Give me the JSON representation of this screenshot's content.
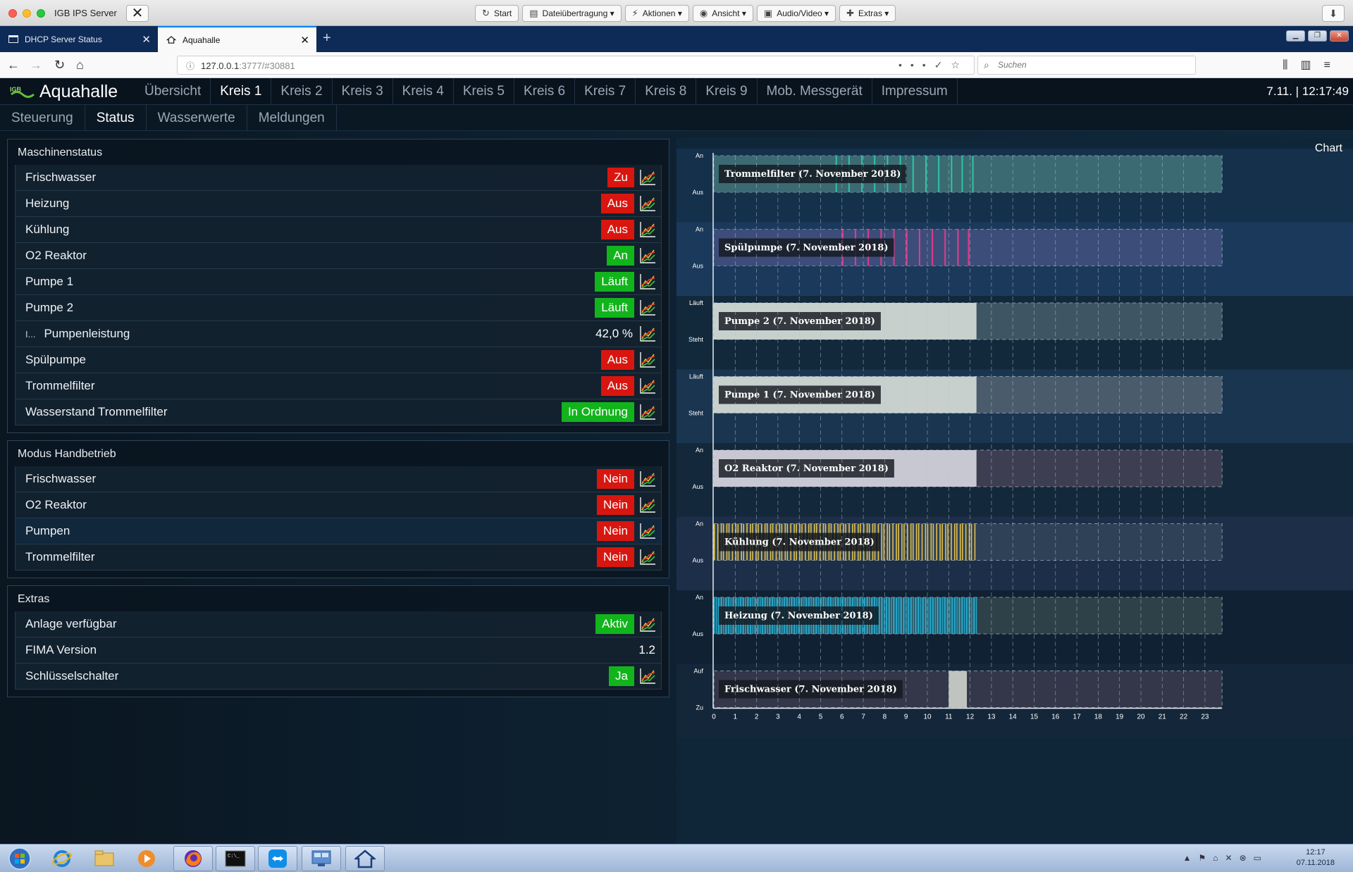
{
  "window": {
    "title": "IGB IPS Server"
  },
  "remote_toolbar": {
    "buttons": [
      {
        "label": "Start",
        "icon": "refresh-icon"
      },
      {
        "label": "Dateiübertragung ▾",
        "icon": "file-icon"
      },
      {
        "label": "Aktionen ▾",
        "icon": "lightning-icon"
      },
      {
        "label": "Ansicht ▾",
        "icon": "eye-icon"
      },
      {
        "label": "Audio/Video ▾",
        "icon": "chat-icon"
      },
      {
        "label": "Extras ▾",
        "icon": "puzzle-icon"
      }
    ]
  },
  "browser": {
    "tabs": [
      {
        "label": "DHCP Server Status"
      },
      {
        "label": "Aquahalle"
      }
    ],
    "url_host": "127.0.0.1",
    "url_rest": ":3777/#30881",
    "search_placeholder": "Suchen"
  },
  "app": {
    "name": "Aquahalle",
    "clock": "7.11. | 12:17:49",
    "main_tabs": [
      {
        "label": "Übersicht",
        "active": false
      },
      {
        "label": "Kreis 1",
        "active": true
      },
      {
        "label": "Kreis 2",
        "active": false
      },
      {
        "label": "Kreis 3",
        "active": false
      },
      {
        "label": "Kreis 4",
        "active": false
      },
      {
        "label": "Kreis 5",
        "active": false
      },
      {
        "label": "Kreis 6",
        "active": false
      },
      {
        "label": "Kreis 7",
        "active": false
      },
      {
        "label": "Kreis 8",
        "active": false
      },
      {
        "label": "Kreis 9",
        "active": false
      },
      {
        "label": "Mob. Messgerät",
        "active": false
      },
      {
        "label": "Impressum",
        "active": false
      }
    ],
    "sub_tabs": [
      {
        "label": "Steuerung",
        "active": false
      },
      {
        "label": "Status",
        "active": true
      },
      {
        "label": "Wasserwerte",
        "active": false
      },
      {
        "label": "Meldungen",
        "active": false
      }
    ]
  },
  "panels": [
    {
      "title": "Maschinenstatus",
      "rows": [
        {
          "label": "Frischwasser",
          "value": "Zu",
          "color": "red",
          "chart": true
        },
        {
          "label": "Heizung",
          "value": "Aus",
          "color": "red",
          "chart": true
        },
        {
          "label": "Kühlung",
          "value": "Aus",
          "color": "red",
          "chart": true
        },
        {
          "label": "O2 Reaktor",
          "value": "An",
          "color": "green",
          "chart": true
        },
        {
          "label": "Pumpe 1",
          "value": "Läuft",
          "color": "green",
          "chart": true
        },
        {
          "label": "Pumpe 2",
          "value": "Läuft",
          "color": "green",
          "chart": true
        },
        {
          "label": "Pumpenleistung",
          "prefix": "I...",
          "value": "42,0 %",
          "color": "none",
          "chart": true,
          "sub": true
        },
        {
          "label": "Spülpumpe",
          "value": "Aus",
          "color": "red",
          "chart": true
        },
        {
          "label": "Trommelfilter",
          "value": "Aus",
          "color": "red",
          "chart": true
        },
        {
          "label": "Wasserstand Trommelfilter",
          "value": "In Ordnung",
          "color": "green",
          "chart": true
        }
      ]
    },
    {
      "title": "Modus Handbetrieb",
      "rows": [
        {
          "label": "Frischwasser",
          "value": "Nein",
          "color": "red",
          "chart": true
        },
        {
          "label": "O2 Reaktor",
          "value": "Nein",
          "color": "red",
          "chart": true
        },
        {
          "label": "Pumpen",
          "value": "Nein",
          "color": "red",
          "chart": true
        },
        {
          "label": "Trommelfilter",
          "value": "Nein",
          "color": "red",
          "chart": true
        }
      ]
    },
    {
      "title": "Extras",
      "rows": [
        {
          "label": "Anlage verfügbar",
          "value": "Aktiv",
          "color": "green",
          "chart": true
        },
        {
          "label": "FIMA Version",
          "value": "1.2",
          "color": "none",
          "chart": false
        },
        {
          "label": "Schlüsselschalter",
          "value": "Ja",
          "color": "green",
          "chart": true
        }
      ]
    }
  ],
  "chart_data": {
    "type": "area",
    "title": "Chart",
    "x": {
      "ticks": [
        "0",
        "1",
        "2",
        "3",
        "4",
        "5",
        "6",
        "7",
        "8",
        "9",
        "10",
        "11",
        "12",
        "13",
        "14",
        "15",
        "16",
        "17",
        "18",
        "19",
        "20",
        "21",
        "22",
        "23"
      ],
      "range": [
        0,
        24
      ],
      "unit": "hour"
    },
    "current_hour": 12.3,
    "series": [
      {
        "name": "Trommelfilter (7. November 2018)",
        "on_label": "An",
        "off_label": "Aus",
        "color": "#2ec4a6",
        "bg": "#3b6a72",
        "pattern": "pulses",
        "pulses": [
          5.7,
          6.3,
          6.9,
          7.5,
          8.1,
          8.7,
          9.3,
          9.9,
          10.5,
          11.1,
          11.6,
          12.1
        ]
      },
      {
        "name": "Spülpumpe (7. November 2018)",
        "on_label": "An",
        "off_label": "Aus",
        "color": "#e03c8c",
        "bg": "#3d4d7a",
        "pattern": "pulses",
        "pulses": [
          6.0,
          6.6,
          7.2,
          7.8,
          8.4,
          9.0,
          9.6,
          10.2,
          10.8,
          11.4,
          11.9
        ]
      },
      {
        "name": "Pumpe 2 (7. November 2018)",
        "on_label": "Läuft",
        "off_label": "Steht",
        "color": "#c7d0cc",
        "bg": "#3e5664",
        "pattern": "solid",
        "on_from": 0,
        "on_to": 12.3
      },
      {
        "name": "Pumpe 1 (7. November 2018)",
        "on_label": "Läuft",
        "off_label": "Steht",
        "color": "#c7d0cc",
        "bg": "#4a5b6c",
        "pattern": "solid",
        "on_from": 0,
        "on_to": 12.3
      },
      {
        "name": "O2 Reaktor (7. November 2018)",
        "on_label": "An",
        "off_label": "Aus",
        "color": "#c8c8d2",
        "bg": "#3e3e52",
        "pattern": "solid",
        "on_from": 0,
        "on_to": 12.3
      },
      {
        "name": "Kühlung (7. November 2018)",
        "on_label": "An",
        "off_label": "Aus",
        "color": "#e4c14c",
        "bg": "#2e4157",
        "pattern": "dense",
        "density": 90
      },
      {
        "name": "Heizung (7. November 2018)",
        "on_label": "An",
        "off_label": "Aus",
        "color": "#25a3c6",
        "bg": "#2e4149",
        "pattern": "dense",
        "density": 180
      },
      {
        "name": "Frischwasser (7. November 2018)",
        "on_label": "Auf",
        "off_label": "Zu",
        "color": "#c0c4c0",
        "bg": "#34374a",
        "pattern": "solid",
        "on_from": 11.0,
        "on_to": 11.85
      }
    ]
  },
  "taskbar": {
    "clock_time": "12:17",
    "clock_date": "07.11.2018",
    "items": [
      "start-orb-icon",
      "internet-explorer-icon",
      "explorer-folder-icon",
      "media-player-icon",
      "firefox-icon",
      "terminal-icon",
      "teamviewer-icon",
      "control-panel-icon",
      "home-icon"
    ]
  }
}
